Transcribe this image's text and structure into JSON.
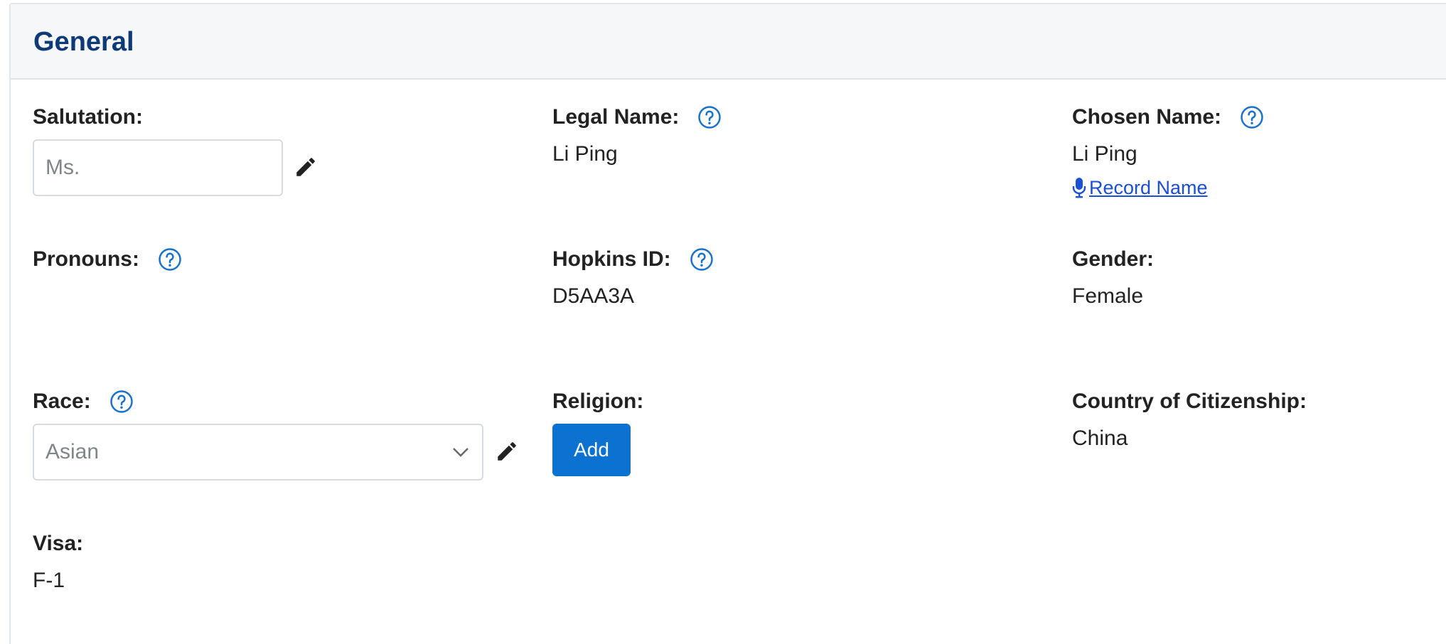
{
  "panel": {
    "title": "General"
  },
  "fields": {
    "salutation": {
      "label": "Salutation:",
      "placeholder": "Ms."
    },
    "legal_name": {
      "label": "Legal Name:",
      "value": "Li Ping"
    },
    "chosen_name": {
      "label": "Chosen Name:",
      "value": "Li Ping",
      "record_link": "Record Name"
    },
    "pronouns": {
      "label": "Pronouns:",
      "value": ""
    },
    "hopkins_id": {
      "label": "Hopkins ID:",
      "value": "D5AA3A"
    },
    "gender": {
      "label": "Gender:",
      "value": "Female"
    },
    "race": {
      "label": "Race:",
      "selected": "Asian"
    },
    "religion": {
      "label": "Religion:",
      "add_button": "Add"
    },
    "citizenship": {
      "label": "Country of Citizenship:",
      "value": "China"
    },
    "visa": {
      "label": "Visa:",
      "value": "F-1"
    }
  },
  "icons": {
    "help": "question-circle-icon",
    "edit": "pencil-icon",
    "microphone": "microphone-icon",
    "chevron": "chevron-down-icon"
  },
  "colors": {
    "title": "#0e3a78",
    "help_icon": "#1a73c8",
    "link": "#1a4fd6",
    "primary_button": "#0b72d1",
    "header_bg": "#f6f7f9"
  }
}
